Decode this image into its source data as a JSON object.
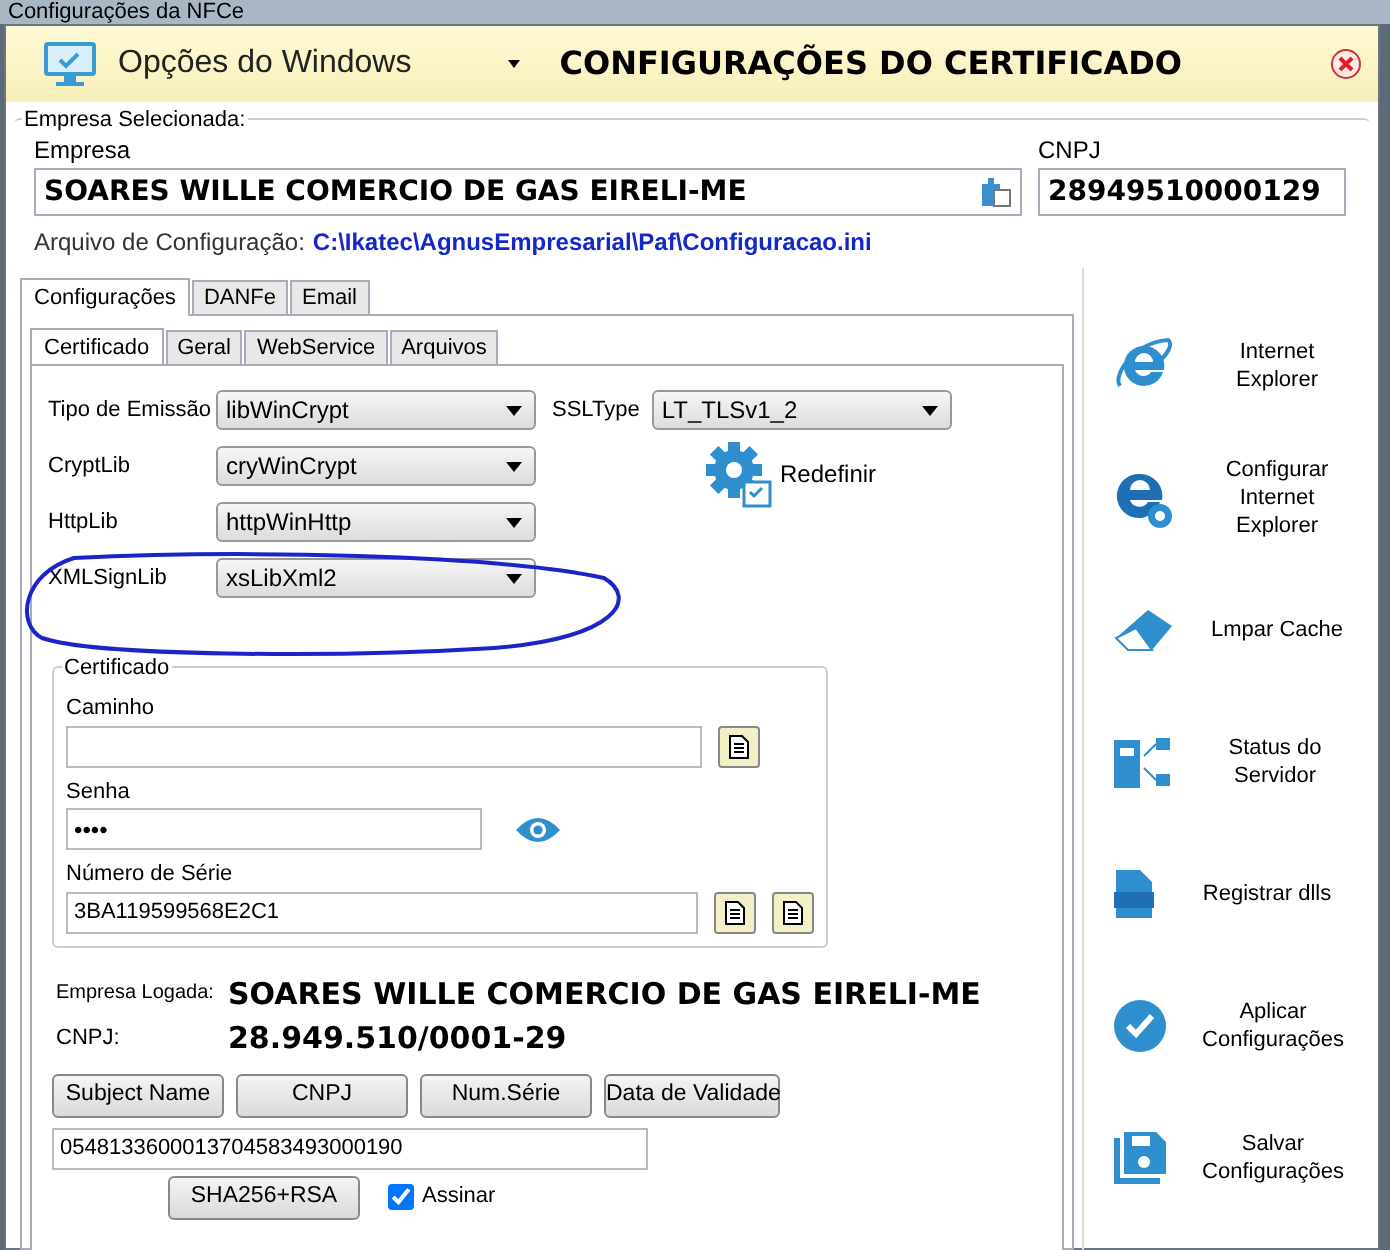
{
  "window": {
    "title": "Configurações da NFCe"
  },
  "header": {
    "menu_label": "Opções do Windows",
    "title": "CONFIGURAÇÕES DO CERTIFICADO"
  },
  "selected_company": {
    "legend": "Empresa Selecionada:",
    "company_label": "Empresa",
    "company_value": "SOARES WILLE COMERCIO DE GAS EIRELI-ME",
    "cnpj_label": "CNPJ",
    "cnpj_value": "28949510000129",
    "config_file_label": "Arquivo de Configuração:",
    "config_file_path": "C:\\Ikatec\\AgnusEmpresarial\\Paf\\Configuracao.ini"
  },
  "tabs": [
    {
      "label": "Configurações",
      "selected": true
    },
    {
      "label": "DANFe",
      "selected": false
    },
    {
      "label": "Email",
      "selected": false
    }
  ],
  "subtabs": [
    {
      "label": "Certificado",
      "selected": true
    },
    {
      "label": "Geral",
      "selected": false
    },
    {
      "label": "WebService",
      "selected": false
    },
    {
      "label": "Arquivos",
      "selected": false
    }
  ],
  "emission": {
    "label": "Tipo de Emissão",
    "value": "libWinCrypt"
  },
  "ssl": {
    "label": "SSLType",
    "value": "LT_TLSv1_2"
  },
  "libs": [
    {
      "label": "CryptLib",
      "value": "cryWinCrypt"
    },
    {
      "label": "HttpLib",
      "value": "httpWinHttp"
    },
    {
      "label": "XMLSignLib",
      "value": "xsLibXml2"
    }
  ],
  "reset_button": "Redefinir",
  "certificate": {
    "legend": "Certificado",
    "path_label": "Caminho",
    "password_label": "Senha",
    "password_value": "••••",
    "serial_label": "Número de Série",
    "serial_value": "3BA119599568E2C1"
  },
  "logged": {
    "company_label": "Empresa Logada:",
    "company_value": "SOARES WILLE COMERCIO DE GAS EIRELI-ME",
    "cnpj_label": "CNPJ:",
    "cnpj_value": "28.949.510/0001-29"
  },
  "action_buttons": [
    "Subject Name",
    "CNPJ",
    "Num.Série",
    "Data de Validade"
  ],
  "result_value": "0548133600013704583493000190",
  "sign_button": "SHA256+RSA",
  "sign_checkbox": {
    "label": "Assinar",
    "checked": true
  },
  "sidebar": [
    {
      "kind": "ie",
      "lines": [
        "Internet",
        "Explorer"
      ]
    },
    {
      "kind": "ie-settings",
      "lines": [
        "Configurar",
        "Internet",
        "Explorer"
      ]
    },
    {
      "kind": "eraser",
      "lines": [
        "Lmpar Cache"
      ]
    },
    {
      "kind": "server",
      "lines": [
        "Status do",
        "Servidor"
      ]
    },
    {
      "kind": "dll",
      "lines": [
        "Registrar dlls"
      ]
    },
    {
      "kind": "check",
      "lines": [
        "Aplicar",
        "Configurações"
      ]
    },
    {
      "kind": "save",
      "lines": [
        "Salvar",
        "Configurações"
      ]
    }
  ]
}
